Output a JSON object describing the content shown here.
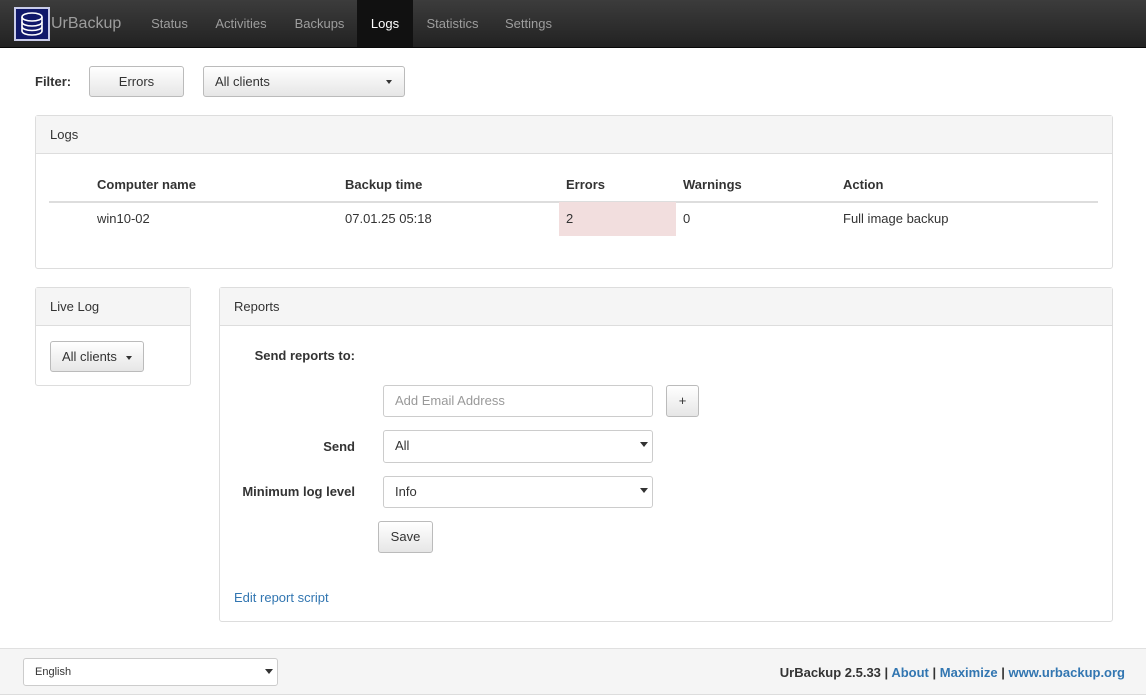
{
  "navbar": {
    "brand": "UrBackup",
    "items": [
      {
        "label": "Status"
      },
      {
        "label": "Activities"
      },
      {
        "label": "Backups"
      },
      {
        "label": "Logs"
      },
      {
        "label": "Statistics"
      },
      {
        "label": "Settings"
      }
    ],
    "active": "Logs"
  },
  "filter": {
    "label": "Filter:",
    "level_value": "Errors",
    "clients_value": "All clients"
  },
  "logs_panel": {
    "title": "Logs",
    "columns": [
      "Computer name",
      "Backup time",
      "Errors",
      "Warnings",
      "Action"
    ],
    "rows": [
      {
        "computer": "win10-02",
        "time": "07.01.25 05:18",
        "errors": "2",
        "warnings": "0",
        "action": "Full image backup"
      }
    ]
  },
  "live_log": {
    "title": "Live Log",
    "clients_button": "All clients"
  },
  "reports": {
    "title": "Reports",
    "send_reports_label": "Send reports to:",
    "email_placeholder": "Add Email Address",
    "add_button": "+",
    "send_label": "Send",
    "send_value": "All",
    "min_level_label": "Minimum log level",
    "min_level_value": "Info",
    "save_button": "Save",
    "edit_script_link": "Edit report script"
  },
  "footer": {
    "language": "English",
    "version": "UrBackup 2.5.33",
    "sep": "|",
    "about": "About",
    "maximize": "Maximize",
    "site": "www.urbackup.org"
  },
  "colors": {
    "navbar": "#222222",
    "error_cell": "#f2dede",
    "link": "#3276b1"
  }
}
